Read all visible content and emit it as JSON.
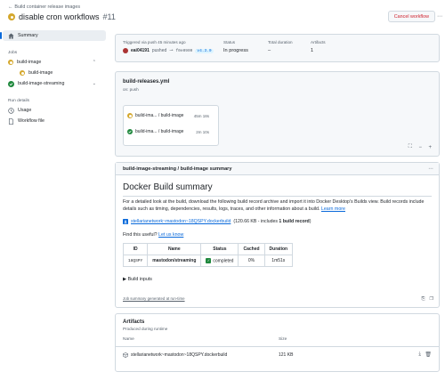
{
  "header": {
    "back_label": "Build container release images",
    "title": "disable cron workflows",
    "run_number": "#11",
    "cancel_label": "Cancel workflow"
  },
  "sidebar": {
    "summary_label": "Summary",
    "jobs_label": "Jobs",
    "jobs": [
      {
        "label": "build-image",
        "status": "pending",
        "children": [
          {
            "label": "build-image",
            "status": "pending"
          }
        ]
      },
      {
        "label": "build-image-streaming",
        "status": "success"
      }
    ],
    "run_details_label": "Run details",
    "details": [
      {
        "label": "Usage",
        "icon": "clock-icon"
      },
      {
        "label": "Workflow file",
        "icon": "file-icon"
      }
    ]
  },
  "run_summary": {
    "trigger_label": "Triggered via push 45 minutes ago",
    "actor": "eai04191",
    "pushed_word": "pushed",
    "commit": "f0e0909",
    "tag": "v4.3.0",
    "status_label": "Status",
    "status_value": "In progress",
    "duration_label": "Total duration",
    "duration_value": "–",
    "artifacts_label": "Artifacts",
    "artifacts_value": "1"
  },
  "graph": {
    "workflow_file": "build-releases.yml",
    "trigger": "on: push",
    "jobs": [
      {
        "label": "build-ima... / build-image",
        "duration": "45m 18s",
        "status": "pending"
      },
      {
        "label": "build-ima... / build-image",
        "duration": "2m 10s",
        "status": "success"
      }
    ]
  },
  "job_summary": {
    "header": "build-image-streaming / build-image summary",
    "title": "Docker Build summary",
    "para_1": "For a detailed look at the build, download the following build record archive and import it into Docker Desktop's Builds view. Build records include details such as timing, dependencies, results, logs, traces, and other information about a build. ",
    "learn_more": "Learn more",
    "download_link": "stellarianetwork~mastodon~18QSPY.dockerbuild",
    "download_meta_pre": " (120.66 KB - includes ",
    "download_meta_bold": "1 build record",
    "download_meta_post": ")",
    "find_useful": "Find this useful? ",
    "let_us_know": "Let us know",
    "table": {
      "headers": [
        "ID",
        "Name",
        "Status",
        "Cached",
        "Duration"
      ],
      "row": {
        "id": "18QSPY",
        "name": "mastodon/streaming",
        "status": "completed",
        "cached": "0%",
        "duration": "1m51s"
      }
    },
    "build_inputs": "Build inputs",
    "generated": "Job summary generated at run-time"
  },
  "artifacts": {
    "title": "Artifacts",
    "subtitle": "Produced during runtime",
    "col_name": "Name",
    "col_size": "Size",
    "items": [
      {
        "name": "stellarianetwork~mastodon~18QSPY.dockerbuild",
        "size": "121 KB"
      }
    ]
  },
  "colors": {
    "accent": "#0969da",
    "pending": "#d4a72c",
    "success": "#1f883d",
    "danger": "#cf222e"
  }
}
